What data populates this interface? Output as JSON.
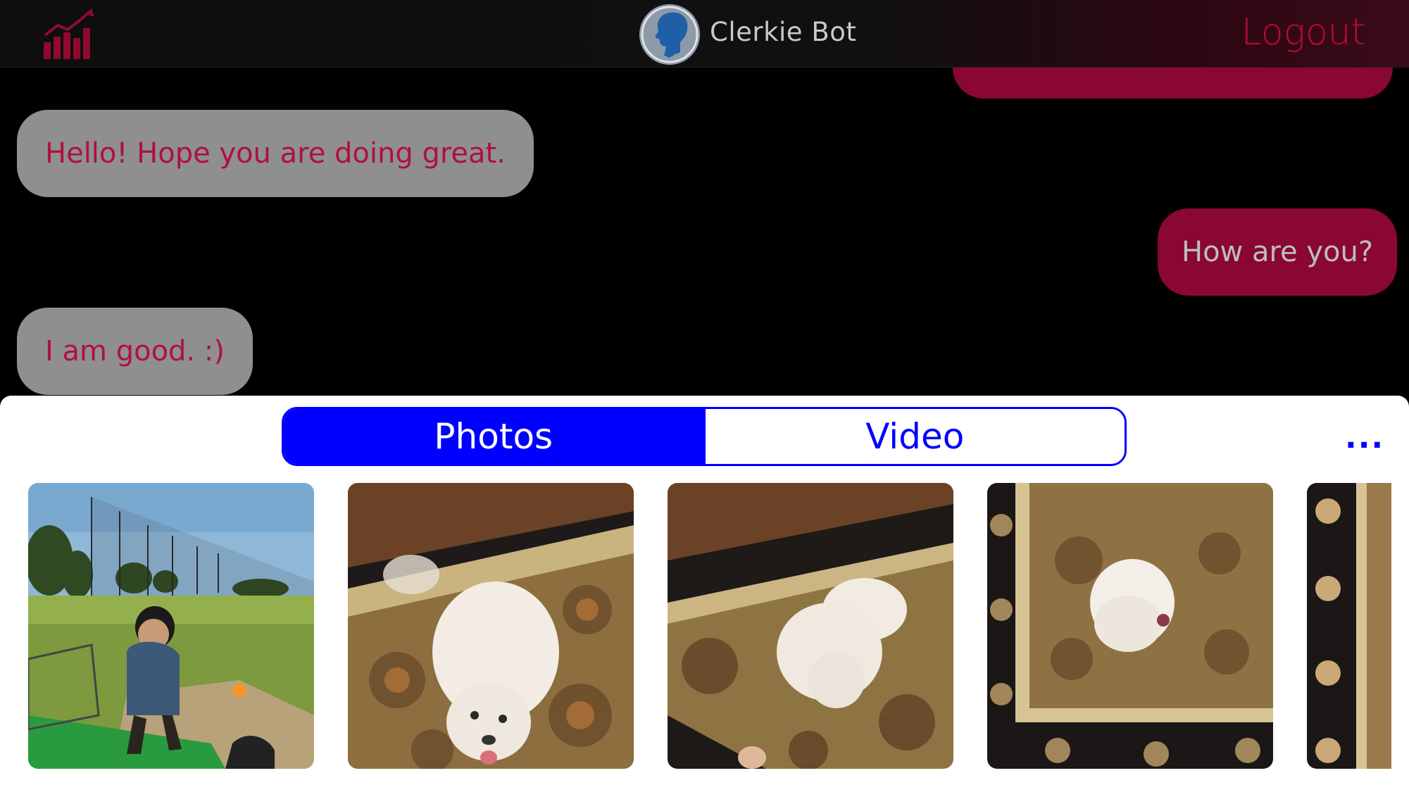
{
  "header": {
    "bot_name": "Clerkie Bot",
    "logout_label": "Logout",
    "left_icon": "bar-chart-trend-icon",
    "avatar_icon": "silhouette-avatar-icon"
  },
  "chat": {
    "messages": [
      {
        "sender": "user",
        "text": ""
      },
      {
        "sender": "bot",
        "text": "Hello! Hope you are doing great."
      },
      {
        "sender": "user",
        "text": "How are you?"
      },
      {
        "sender": "bot",
        "text": "I am good. :)"
      }
    ]
  },
  "media_picker": {
    "tabs": [
      {
        "label": "Photos",
        "active": true
      },
      {
        "label": "Video",
        "active": false
      }
    ],
    "more_label": "...",
    "thumbnails": [
      {
        "subject": "golf-driving-range"
      },
      {
        "subject": "white-dog-on-rug"
      },
      {
        "subject": "white-dog-on-rug"
      },
      {
        "subject": "white-dog-on-rug"
      },
      {
        "subject": "rug-pattern"
      }
    ]
  },
  "colors": {
    "accent_red": "#b80a35",
    "user_bubble": "#8a0732",
    "bot_bubble": "#8f8f8f",
    "bot_text": "#b0103f",
    "segment_blue": "#0000ff"
  }
}
